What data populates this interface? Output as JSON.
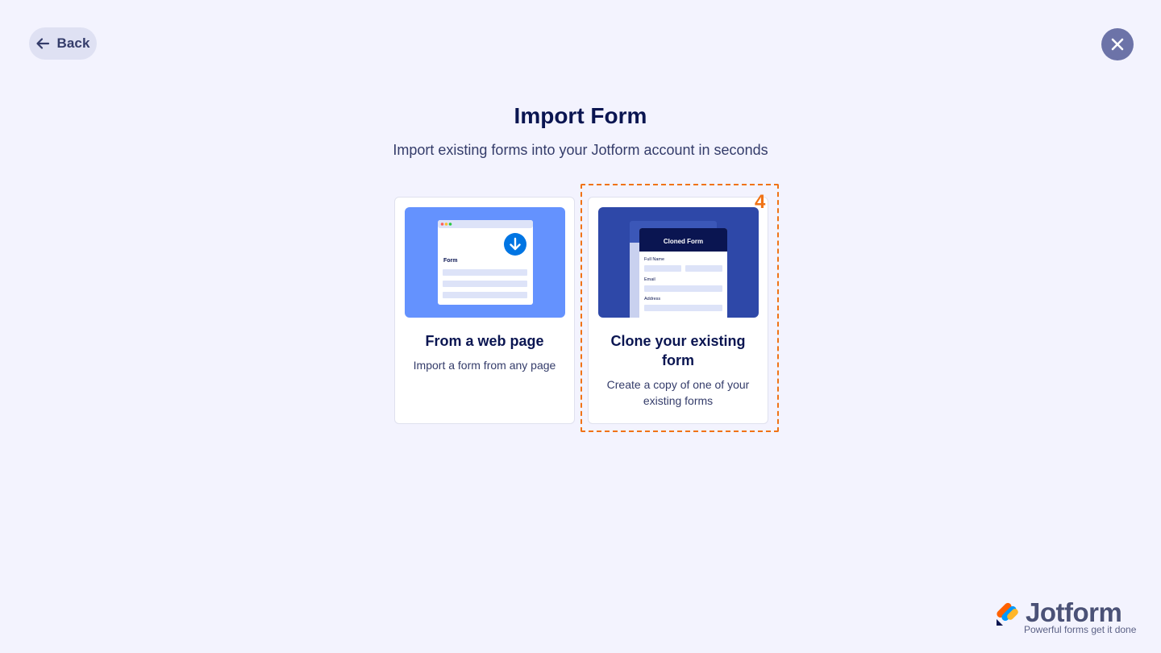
{
  "nav": {
    "back_label": "Back"
  },
  "header": {
    "title": "Import Form",
    "subtitle": "Import existing forms into your Jotform account in seconds"
  },
  "options": [
    {
      "title": "From a web page",
      "description": "Import a form from any page",
      "illustration": {
        "form_label": "Form",
        "icon": "download-icon"
      }
    },
    {
      "title": "Clone your existing form",
      "description": "Create a copy of one of your existing forms",
      "illustration": {
        "header": "Cloned Form",
        "field_1": "Full Name",
        "field_2": "Email",
        "field_3": "Address"
      }
    }
  ],
  "annotation": {
    "badge": "4"
  },
  "brand": {
    "name": "Jotform",
    "tagline": "Powerful forms get it done"
  },
  "colors": {
    "background": "#f3f3fe",
    "primary_text": "#0a1551",
    "accent_blue": "#6492fe",
    "clone_blue": "#2e48a8",
    "highlight_orange": "#f07316",
    "close_button": "#6c73a8"
  }
}
